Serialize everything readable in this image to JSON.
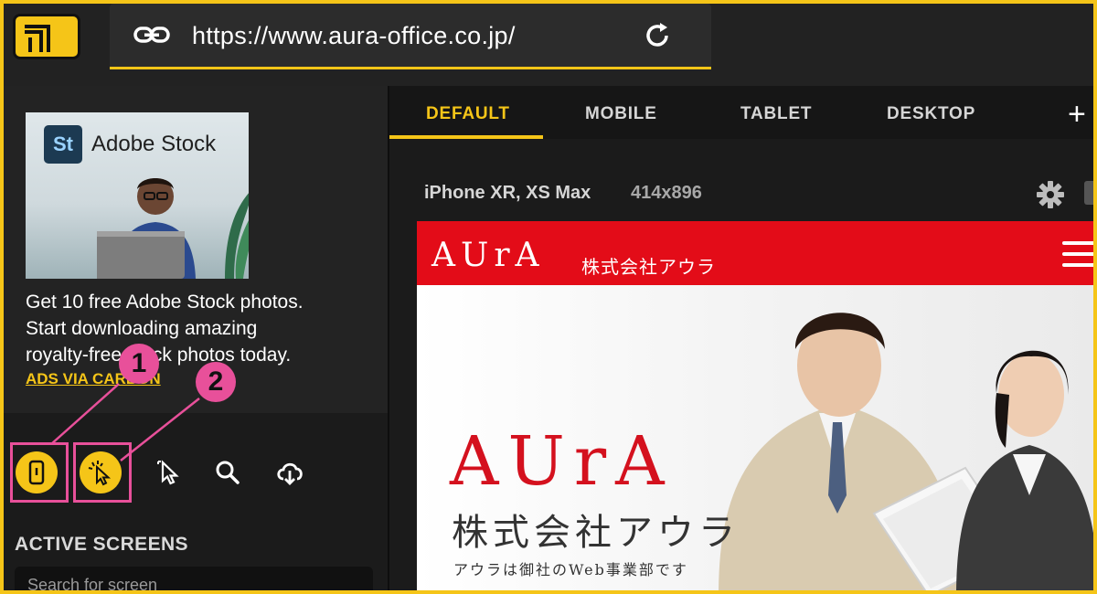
{
  "browser": {
    "url": "https://www.aura-office.co.jp/"
  },
  "sidebar": {
    "ad": {
      "brand_badge": "St",
      "brand_name": "Adobe Stock",
      "copy_line1": "Get 10 free Adobe Stock photos.",
      "copy_line2": "Start downloading amazing",
      "copy_line3": "royalty-free stock photos today.",
      "link": "ADS VIA CARBON"
    },
    "tools": [
      {
        "icon": "mobile-icon",
        "active": true
      },
      {
        "icon": "pointer-sparkle-icon",
        "active": true
      },
      {
        "icon": "cursor-select-icon",
        "active": false
      },
      {
        "icon": "search-icon",
        "active": false
      },
      {
        "icon": "cloud-download-icon",
        "active": false
      }
    ],
    "section_title": "ACTIVE SCREENS",
    "search_placeholder": "Search for screen"
  },
  "annotations": {
    "one": "1",
    "two": "2"
  },
  "tabs": [
    {
      "label": "DEFAULT",
      "active": true
    },
    {
      "label": "MOBILE",
      "active": false
    },
    {
      "label": "TABLET",
      "active": false
    },
    {
      "label": "DESKTOP",
      "active": false
    }
  ],
  "tab_add": "+",
  "device": {
    "name": "iPhone XR, XS Max",
    "size": "414x896"
  },
  "site": {
    "logo": "AUrA",
    "company": "株式会社アウラ",
    "hero_logo": "AUrA",
    "hero_company": "株式会社アウラ",
    "hero_tagline": "アウラは御社のWeb事業部です"
  },
  "colors": {
    "accent": "#f5c518",
    "callout": "#e8509a",
    "site_red": "#e30c18"
  }
}
